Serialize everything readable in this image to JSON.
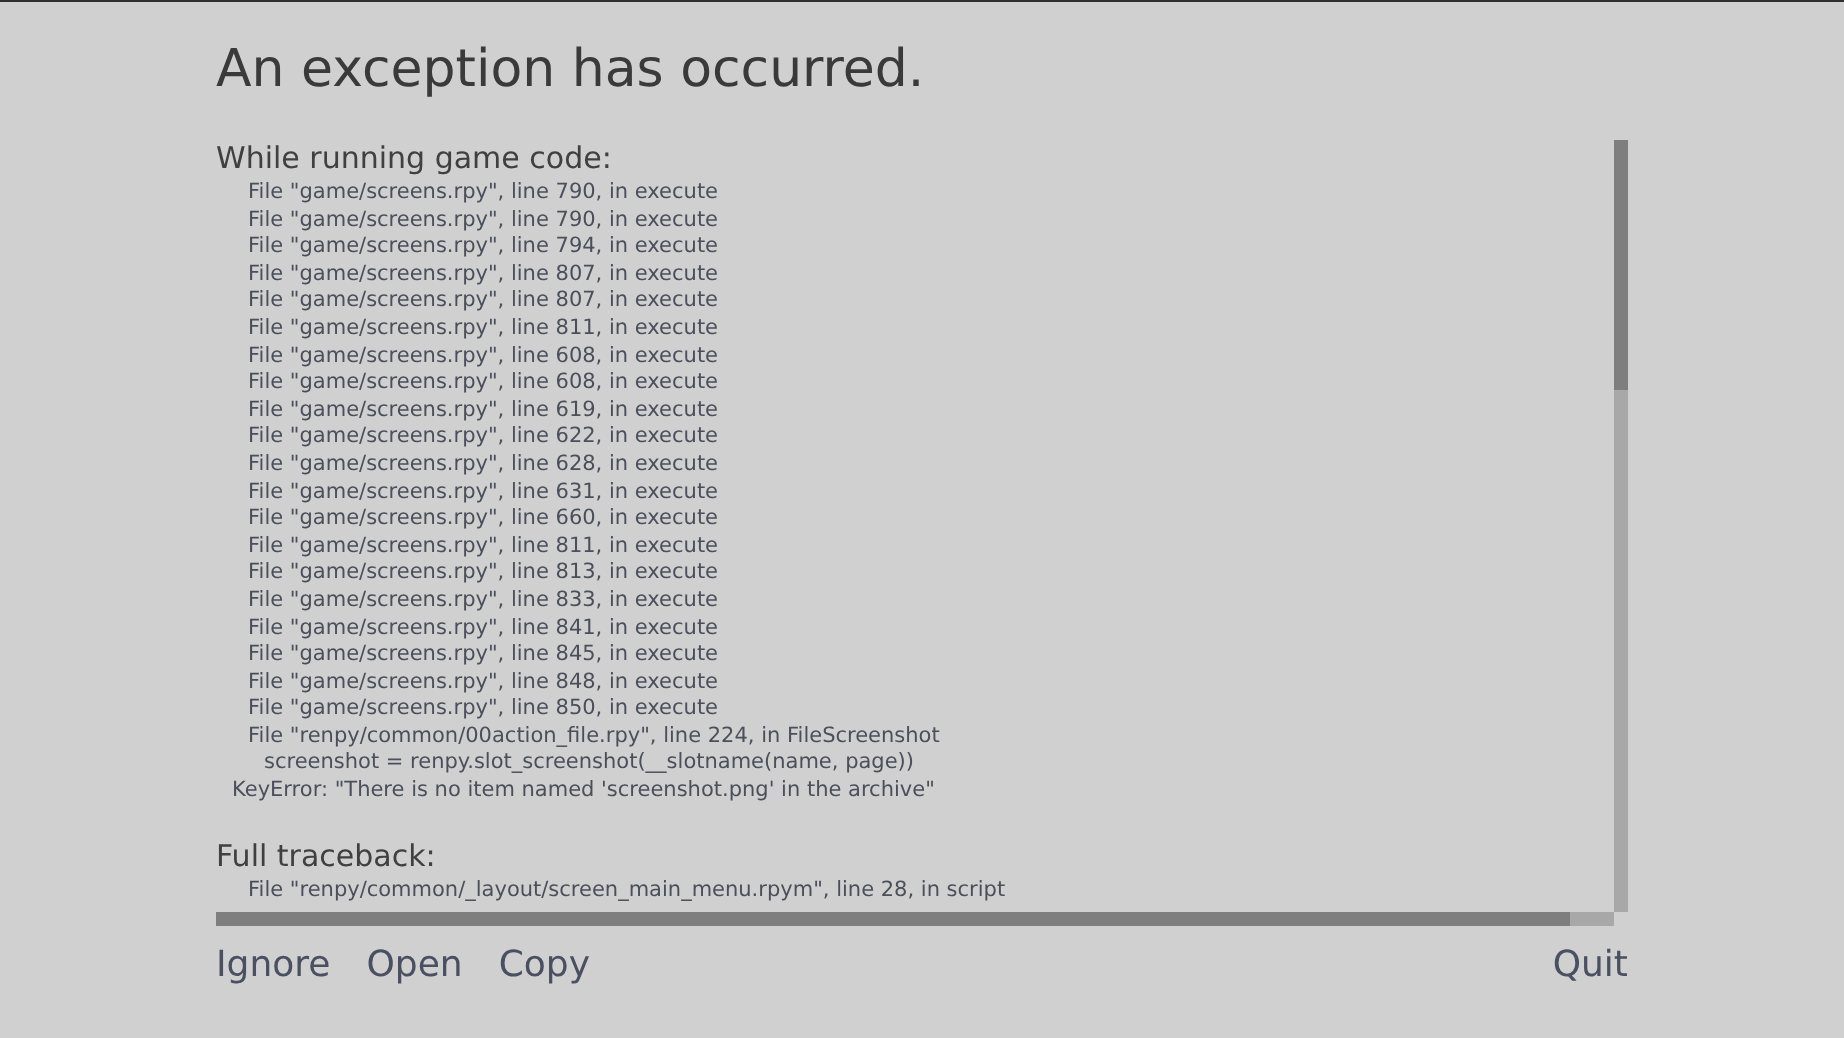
{
  "title": "An exception has occurred.",
  "sections": [
    {
      "heading": "While running game code:",
      "lines": [
        {
          "kind": "frame",
          "text": "File \"game/screens.rpy\", line 790, in execute"
        },
        {
          "kind": "frame",
          "text": "File \"game/screens.rpy\", line 790, in execute"
        },
        {
          "kind": "frame",
          "text": "File \"game/screens.rpy\", line 794, in execute"
        },
        {
          "kind": "frame",
          "text": "File \"game/screens.rpy\", line 807, in execute"
        },
        {
          "kind": "frame",
          "text": "File \"game/screens.rpy\", line 807, in execute"
        },
        {
          "kind": "frame",
          "text": "File \"game/screens.rpy\", line 811, in execute"
        },
        {
          "kind": "frame",
          "text": "File \"game/screens.rpy\", line 608, in execute"
        },
        {
          "kind": "frame",
          "text": "File \"game/screens.rpy\", line 608, in execute"
        },
        {
          "kind": "frame",
          "text": "File \"game/screens.rpy\", line 619, in execute"
        },
        {
          "kind": "frame",
          "text": "File \"game/screens.rpy\", line 622, in execute"
        },
        {
          "kind": "frame",
          "text": "File \"game/screens.rpy\", line 628, in execute"
        },
        {
          "kind": "frame",
          "text": "File \"game/screens.rpy\", line 631, in execute"
        },
        {
          "kind": "frame",
          "text": "File \"game/screens.rpy\", line 660, in execute"
        },
        {
          "kind": "frame",
          "text": "File \"game/screens.rpy\", line 811, in execute"
        },
        {
          "kind": "frame",
          "text": "File \"game/screens.rpy\", line 813, in execute"
        },
        {
          "kind": "frame",
          "text": "File \"game/screens.rpy\", line 833, in execute"
        },
        {
          "kind": "frame",
          "text": "File \"game/screens.rpy\", line 841, in execute"
        },
        {
          "kind": "frame",
          "text": "File \"game/screens.rpy\", line 845, in execute"
        },
        {
          "kind": "frame",
          "text": "File \"game/screens.rpy\", line 848, in execute"
        },
        {
          "kind": "frame",
          "text": "File \"game/screens.rpy\", line 850, in execute"
        },
        {
          "kind": "frame",
          "text": "File \"renpy/common/00action_file.rpy\", line 224, in FileScreenshot"
        },
        {
          "kind": "code",
          "text": "screenshot = renpy.slot_screenshot(__slotname(name, page))"
        },
        {
          "kind": "error",
          "text": "KeyError: \"There is no item named 'screenshot.png' in the archive\""
        }
      ]
    },
    {
      "heading": "Full traceback:",
      "lines": [
        {
          "kind": "frame",
          "text": "File \"renpy/common/_layout/screen_main_menu.rpym\", line 28, in script"
        }
      ]
    }
  ],
  "buttons": [
    {
      "label": "Ignore",
      "kind": "left"
    },
    {
      "label": "Open",
      "kind": "left"
    },
    {
      "label": "Copy",
      "kind": "left"
    },
    {
      "label": "Quit",
      "kind": "right"
    }
  ]
}
